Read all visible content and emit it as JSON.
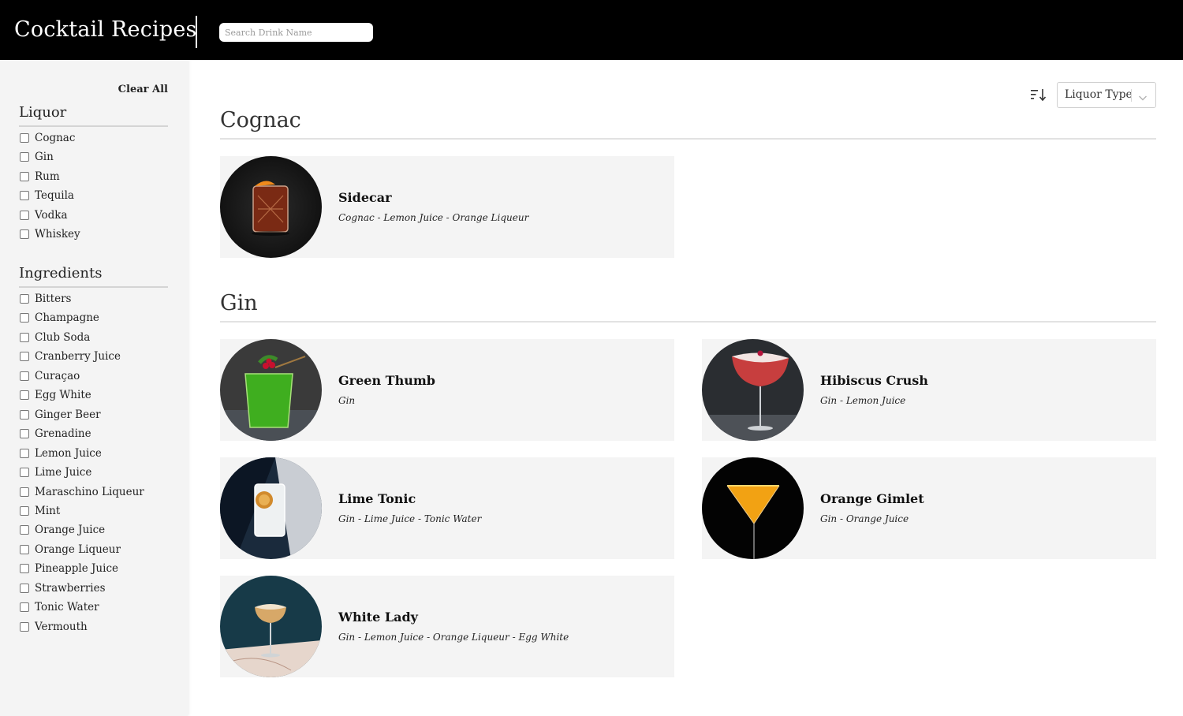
{
  "header": {
    "title": "Cocktail Recipes",
    "search_placeholder": "Search Drink Name",
    "search_value": ""
  },
  "sidebar": {
    "clear_all_label": "Clear All",
    "groups": [
      {
        "title": "Liquor",
        "items": [
          "Cognac",
          "Gin",
          "Rum",
          "Tequila",
          "Vodka",
          "Whiskey"
        ]
      },
      {
        "title": "Ingredients",
        "items": [
          "Bitters",
          "Champagne",
          "Club Soda",
          "Cranberry Juice",
          "Curaçao",
          "Egg White",
          "Ginger Beer",
          "Grenadine",
          "Lemon Juice",
          "Lime Juice",
          "Maraschino Liqueur",
          "Mint",
          "Orange Juice",
          "Orange Liqueur",
          "Pineapple Juice",
          "Strawberries",
          "Tonic Water",
          "Vermouth"
        ]
      }
    ]
  },
  "toolbar": {
    "sort_icon": "sort-descending-icon",
    "sort_select_value": "Liquor Type",
    "sort_select_icon": "chevron-down-icon"
  },
  "sections": [
    {
      "title": "Cognac",
      "drinks": [
        {
          "name": "Sidecar",
          "ingredients": "Cognac - Lemon Juice - Orange Liqueur",
          "photo": "rocks-glass-dark-photo"
        }
      ]
    },
    {
      "title": "Gin",
      "drinks": [
        {
          "name": "Green Thumb",
          "ingredients": "Gin",
          "photo": "green-cocktail-photo"
        },
        {
          "name": "Hibiscus Crush",
          "ingredients": "Gin - Lemon Juice",
          "photo": "pink-coupe-photo"
        },
        {
          "name": "Lime Tonic",
          "ingredients": "Gin - Lime Juice - Tonic Water",
          "photo": "lime-highball-photo"
        },
        {
          "name": "Orange Gimlet",
          "ingredients": "Gin - Orange Juice",
          "photo": "orange-martini-photo"
        },
        {
          "name": "White Lady",
          "ingredients": "Gin - Lemon Juice - Orange Liqueur - Egg White",
          "photo": "white-coupe-photo"
        }
      ]
    }
  ],
  "colors": {
    "header_bg": "#000000",
    "sidebar_bg": "#f4f4f4",
    "card_bg": "#f4f4f4"
  }
}
